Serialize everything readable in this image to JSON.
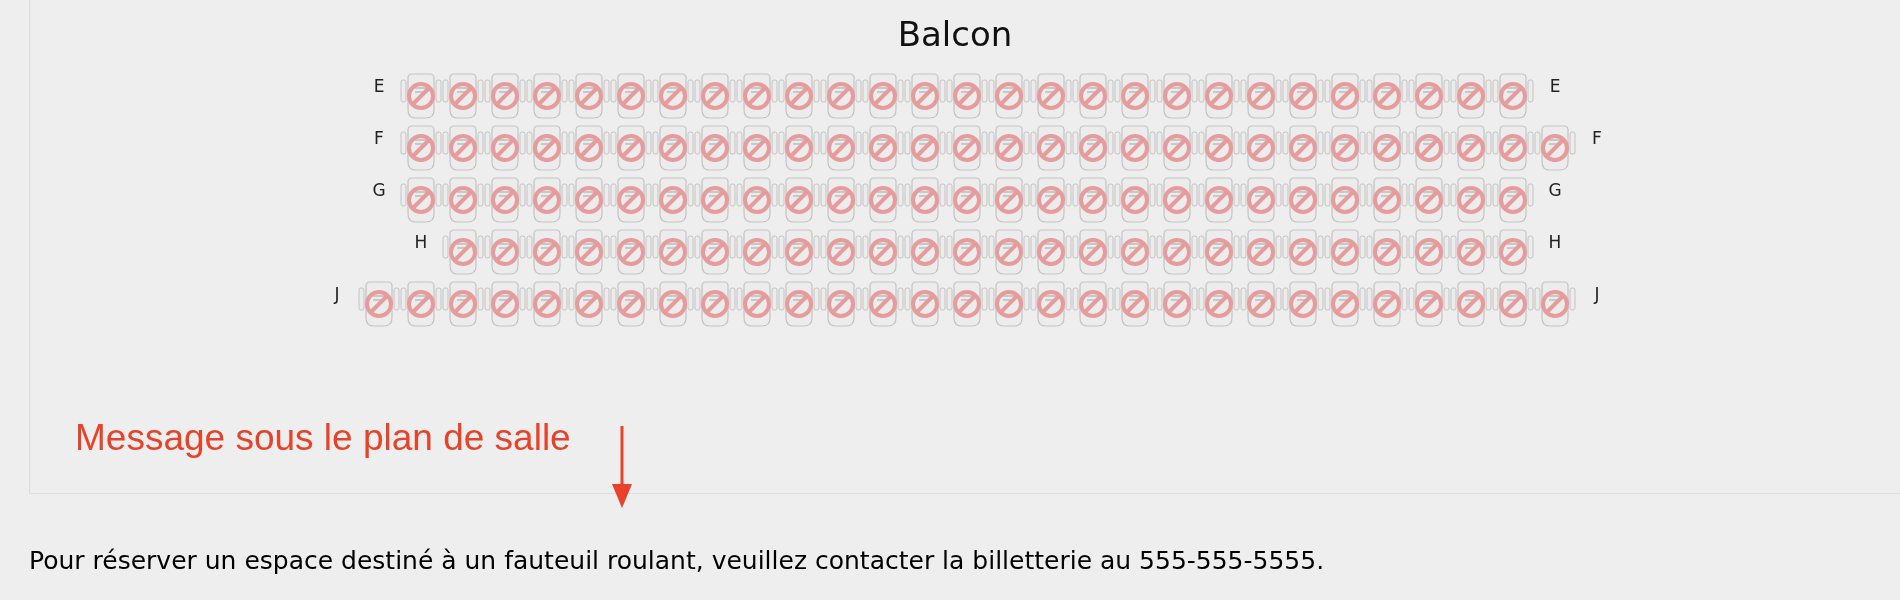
{
  "section_title": "Balcon",
  "rows": [
    {
      "label_left": "E",
      "label_right": "E",
      "seats": [
        {
          "available": false
        },
        {
          "available": false
        },
        {
          "available": false
        },
        {
          "available": false
        },
        {
          "available": false
        },
        {
          "available": false
        },
        {
          "available": false
        },
        {
          "available": false
        },
        {
          "available": false
        },
        {
          "available": false
        },
        {
          "available": false
        },
        {
          "available": false
        },
        {
          "available": false
        },
        {
          "available": false
        },
        {
          "available": false
        },
        {
          "available": false
        },
        {
          "available": false
        },
        {
          "available": false
        },
        {
          "available": false
        },
        {
          "available": false
        },
        {
          "available": false
        },
        {
          "available": false
        },
        {
          "available": false
        },
        {
          "available": false
        },
        {
          "available": false
        },
        {
          "available": false
        },
        {
          "available": false
        }
      ]
    },
    {
      "label_left": "F",
      "label_right": "F",
      "seats": [
        {
          "available": false
        },
        {
          "available": false
        },
        {
          "available": false
        },
        {
          "available": false
        },
        {
          "available": false
        },
        {
          "available": false
        },
        {
          "available": false
        },
        {
          "available": false
        },
        {
          "available": false
        },
        {
          "available": false
        },
        {
          "available": false
        },
        {
          "available": false
        },
        {
          "available": false
        },
        {
          "available": false
        },
        {
          "available": false
        },
        {
          "available": false
        },
        {
          "available": false
        },
        {
          "available": false
        },
        {
          "available": false
        },
        {
          "available": false
        },
        {
          "available": false
        },
        {
          "available": false
        },
        {
          "available": false
        },
        {
          "available": false
        },
        {
          "available": false
        },
        {
          "available": false
        },
        {
          "available": false
        },
        {
          "available": false
        }
      ]
    },
    {
      "label_left": "G",
      "label_right": "G",
      "seats": [
        {
          "available": false
        },
        {
          "available": false
        },
        {
          "available": false
        },
        {
          "available": false
        },
        {
          "available": false
        },
        {
          "available": false
        },
        {
          "available": false
        },
        {
          "available": false
        },
        {
          "available": false
        },
        {
          "available": false
        },
        {
          "available": false
        },
        {
          "available": false
        },
        {
          "available": false
        },
        {
          "available": false
        },
        {
          "available": false
        },
        {
          "available": false
        },
        {
          "available": false
        },
        {
          "available": false
        },
        {
          "available": false
        },
        {
          "available": false
        },
        {
          "available": false
        },
        {
          "available": false
        },
        {
          "available": false
        },
        {
          "available": false
        },
        {
          "available": false
        },
        {
          "available": false
        },
        {
          "available": false
        }
      ]
    },
    {
      "label_left": "H",
      "label_right": "H",
      "seats": [
        {
          "available": false
        },
        {
          "available": false
        },
        {
          "available": false
        },
        {
          "available": false
        },
        {
          "available": false
        },
        {
          "available": false
        },
        {
          "available": false
        },
        {
          "available": false
        },
        {
          "available": false
        },
        {
          "available": false
        },
        {
          "available": false
        },
        {
          "available": false
        },
        {
          "available": false
        },
        {
          "available": false
        },
        {
          "available": false
        },
        {
          "available": false
        },
        {
          "available": false
        },
        {
          "available": false
        },
        {
          "available": false
        },
        {
          "available": false
        },
        {
          "available": false
        },
        {
          "available": false
        },
        {
          "available": false
        },
        {
          "available": false
        },
        {
          "available": false
        },
        {
          "available": false
        }
      ]
    },
    {
      "label_left": "J",
      "label_right": "J",
      "seats": [
        {
          "available": false
        },
        {
          "available": false
        },
        {
          "available": false
        },
        {
          "available": false
        },
        {
          "available": false
        },
        {
          "available": false
        },
        {
          "available": false
        },
        {
          "available": false
        },
        {
          "available": false
        },
        {
          "available": false
        },
        {
          "available": false
        },
        {
          "available": false
        },
        {
          "available": false
        },
        {
          "available": false
        },
        {
          "available": false
        },
        {
          "available": false
        },
        {
          "available": false
        },
        {
          "available": false
        },
        {
          "available": false
        },
        {
          "available": false
        },
        {
          "available": false
        },
        {
          "available": false
        },
        {
          "available": false
        },
        {
          "available": false
        },
        {
          "available": false
        },
        {
          "available": false
        },
        {
          "available": false
        },
        {
          "available": false
        },
        {
          "available": false
        }
      ]
    }
  ],
  "annotation": "Message sous le plan de salle",
  "footer_message": "Pour réserver un espace destiné à un fauteuil roulant, veuillez contacter la billetterie au 555-555-5555."
}
